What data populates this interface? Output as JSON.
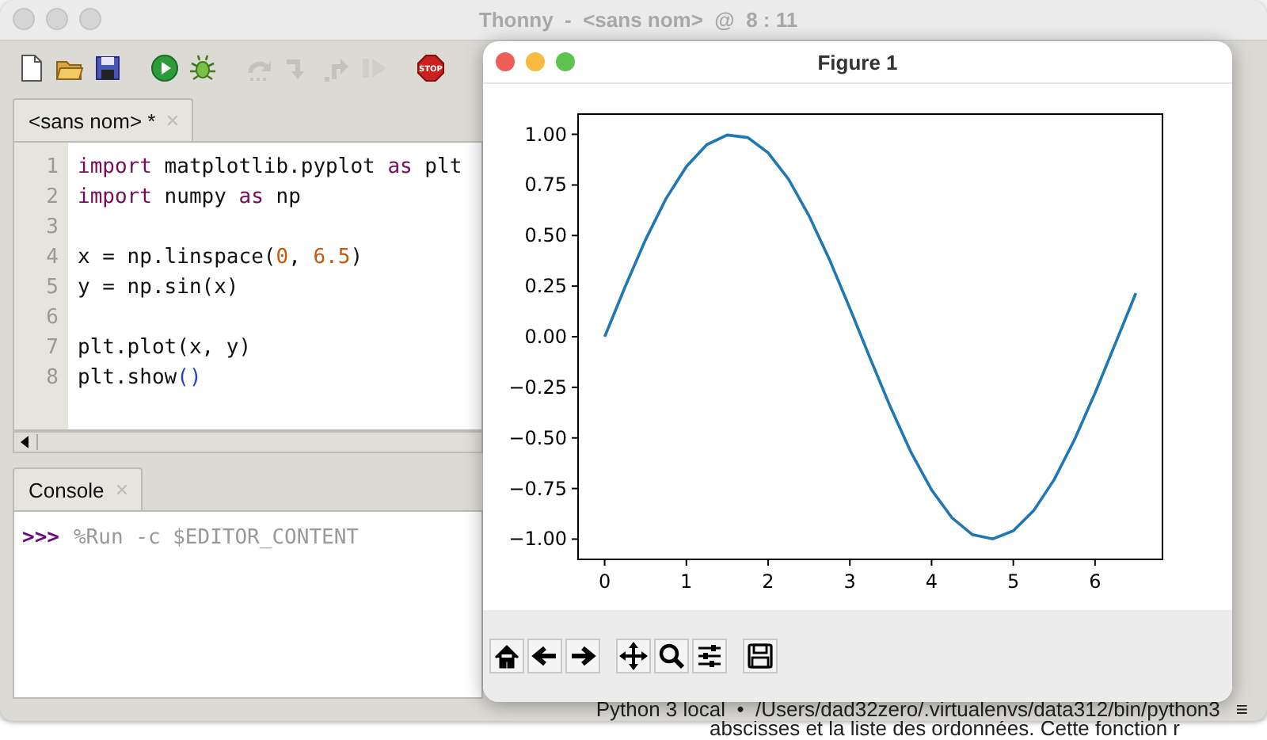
{
  "window": {
    "title": "Thonny  -  <sans nom>  @  8 : 11"
  },
  "toolbar": [
    {
      "kind": "new",
      "disabled": false
    },
    {
      "kind": "open",
      "disabled": false
    },
    {
      "kind": "save",
      "disabled": false
    },
    {
      "kind": "run",
      "disabled": false
    },
    {
      "kind": "debug",
      "disabled": false
    },
    {
      "kind": "step-over",
      "disabled": true
    },
    {
      "kind": "step-into",
      "disabled": true
    },
    {
      "kind": "step-out",
      "disabled": true
    },
    {
      "kind": "resume",
      "disabled": true
    },
    {
      "kind": "stop",
      "disabled": false,
      "label": "STOP"
    }
  ],
  "editor": {
    "tabs": [
      {
        "label": "<sans nom> *",
        "selected": true
      }
    ],
    "lines": [
      {
        "number": "1",
        "tokens": [
          {
            "kind": "keyword",
            "text": "import"
          },
          {
            "kind": "plain",
            "text": " matplotlib.pyplot "
          },
          {
            "kind": "keyword",
            "text": "as"
          },
          {
            "kind": "plain",
            "text": " plt"
          }
        ]
      },
      {
        "number": "2",
        "tokens": [
          {
            "kind": "keyword",
            "text": "import"
          },
          {
            "kind": "plain",
            "text": " numpy "
          },
          {
            "kind": "keyword",
            "text": "as"
          },
          {
            "kind": "plain",
            "text": " np"
          }
        ]
      },
      {
        "number": "3"
      },
      {
        "number": "4",
        "tokens": [
          {
            "kind": "plain",
            "text": "x = np.linspace("
          },
          {
            "kind": "number",
            "text": "0"
          },
          {
            "kind": "plain",
            "text": ", "
          },
          {
            "kind": "number",
            "text": "6.5"
          },
          {
            "kind": "plain",
            "text": ")"
          }
        ]
      },
      {
        "number": "5",
        "tokens": [
          {
            "kind": "plain",
            "text": "y = np.sin(x)"
          }
        ]
      },
      {
        "number": "6"
      },
      {
        "number": "7",
        "tokens": [
          {
            "kind": "plain",
            "text": "plt.plot(x, y)"
          }
        ]
      },
      {
        "number": "8",
        "tokens": [
          {
            "kind": "plain",
            "text": "plt.show"
          },
          {
            "kind": "bracket",
            "text": "()"
          }
        ]
      }
    ]
  },
  "console": {
    "tabs": [
      {
        "label": "Console",
        "selected": true
      }
    ],
    "prompt": ">>>",
    "command": "%Run -c $EDITOR_CONTENT"
  },
  "status_bar": {
    "text": "Python 3 local  •  /Users/dad32zero/.virtualenvs/data312/bin/python3",
    "menu": "≡"
  },
  "background_text": "abscisses et la liste des ordonnées. Cette fonction r",
  "figure": {
    "title": "Figure 1",
    "chart_data": {
      "type": "line",
      "x": [
        0,
        0.25,
        0.5,
        0.75,
        1,
        1.25,
        1.5,
        1.75,
        2,
        2.25,
        2.5,
        2.75,
        3,
        3.25,
        3.5,
        3.75,
        4,
        4.25,
        4.5,
        4.75,
        5,
        5.25,
        5.5,
        5.75,
        6,
        6.25,
        6.5
      ],
      "series": [
        {
          "color": "#1f77b4",
          "values": [
            0,
            0.247,
            0.479,
            0.682,
            0.841,
            0.949,
            0.997,
            0.984,
            0.909,
            0.778,
            0.598,
            0.382,
            0.141,
            -0.108,
            -0.351,
            -0.572,
            -0.757,
            -0.895,
            -0.978,
            -0.999,
            -0.959,
            -0.859,
            -0.706,
            -0.508,
            -0.279,
            -0.033,
            0.215
          ]
        }
      ],
      "xlim": [
        -0.325,
        6.825
      ],
      "ylim": [
        -1.1,
        1.1
      ],
      "xticks": [
        0,
        1,
        2,
        3,
        4,
        5,
        6
      ],
      "yticks": [
        {
          "value": 1,
          "label": "1.00"
        },
        {
          "value": 0.75,
          "label": "0.75"
        },
        {
          "value": 0.5,
          "label": "0.50"
        },
        {
          "value": 0.25,
          "label": "0.25"
        },
        {
          "value": 0,
          "label": "0.00"
        },
        {
          "value": -0.25,
          "label": "−0.25"
        },
        {
          "value": -0.5,
          "label": "−0.50"
        },
        {
          "value": -0.75,
          "label": "−0.75"
        },
        {
          "value": -1,
          "label": "−1.00"
        }
      ]
    },
    "toolbar": [
      {
        "kind": "home"
      },
      {
        "kind": "back"
      },
      {
        "kind": "forward"
      },
      {
        "kind": "pan"
      },
      {
        "kind": "zoom"
      },
      {
        "kind": "configure"
      },
      {
        "kind": "save"
      }
    ]
  }
}
